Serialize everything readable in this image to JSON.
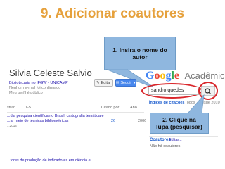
{
  "slide": {
    "title": "9. Adicionar coautores"
  },
  "callouts": {
    "insert_name": "1. Insira o nome do autor",
    "click_lupa": "2. Clique na lupa (pesquisar)"
  },
  "profile": {
    "name": "Silvia Celeste Salvio",
    "affiliation": "Bibliotecária no IFGW - UNICAMP",
    "email_status": "Nenhum e-mail foi confirmado",
    "visibility": "Meu perfil é público"
  },
  "actions": {
    "edit_label": "Editar",
    "follow_label": "Seguir"
  },
  "brand": {
    "logo_letters": [
      "G",
      "o",
      "o",
      "g",
      "l",
      "e"
    ],
    "logo_colors": [
      "#4285f4",
      "#ea4335",
      "#fbbc05",
      "#4285f4",
      "#34a853",
      "#ea4335"
    ],
    "product": "Acadêmico"
  },
  "search": {
    "value": "sandro quedes"
  },
  "citations": {
    "header": "Índices de citações",
    "col_all": "Todos",
    "col_since": "Desde 2010"
  },
  "table": {
    "mostrar_label": "strar",
    "mostrar_value": "1-5",
    "cited_header": "Citado por",
    "year_header": "Ano",
    "rows": [
      {
        "title": "...dia pesquisa científica no Brasil: cartografia temática e",
        "subtitle": "...ar meio de técnicas bibliométricas",
        "extra": "...2014",
        "cited": "26",
        "year": "2006"
      },
      {
        "title": "...tores de produção de indicadores em ciência e",
        "subtitle": "",
        "extra": "",
        "cited": "",
        "year": ""
      }
    ]
  },
  "coauthors": {
    "header": "Coautores",
    "edit_link": "Editar...",
    "empty": "Não há coautores"
  }
}
